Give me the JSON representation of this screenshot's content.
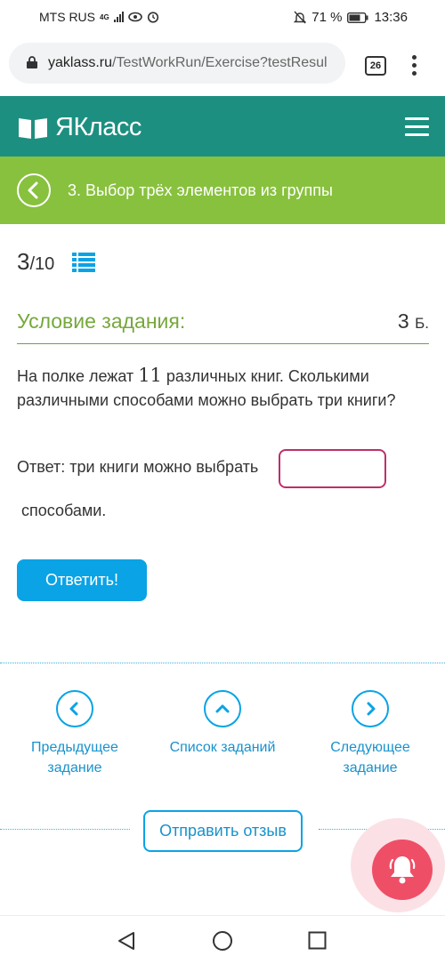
{
  "status_bar": {
    "carrier": "MTS RUS",
    "network": "4G",
    "battery_percent": "71 %",
    "time": "13:36"
  },
  "browser": {
    "url_domain": "yaklass.ru",
    "url_path": "/TestWorkRun/Exercise?testResul",
    "tab_count": "26"
  },
  "header": {
    "brand": "ЯКласс"
  },
  "task": {
    "title": "3. Выбор трёх элементов из группы",
    "counter_current": "3",
    "counter_total": "/10",
    "condition_title": "Условие задания:",
    "points_value": "3",
    "points_unit": "Б.",
    "question_before": "На полке лежат ",
    "question_number": "11",
    "question_after": " различных книг. Сколькими различными способами можно выбрать три книги?",
    "answer_label": "Ответ: три книги можно выбрать",
    "answer_value": "",
    "answer_suffix": "способами.",
    "submit_label": "Ответить!"
  },
  "navigation": {
    "prev_label": "Предыдущее задание",
    "list_label": "Список заданий",
    "next_label": "Следующее задание"
  },
  "feedback": {
    "label": "Отправить отзыв"
  },
  "colors": {
    "header_bg": "#1d8f80",
    "title_bar_bg": "#88c13d",
    "accent_blue": "#0aa3e5",
    "input_border": "#bd2f6a",
    "bell_bg": "#ef4e67"
  },
  "icons": [
    "lock-icon",
    "list-icon",
    "back-arrow-icon",
    "menu-icon",
    "bell-icon",
    "chevron-left-icon",
    "chevron-up-icon",
    "chevron-right-icon"
  ]
}
